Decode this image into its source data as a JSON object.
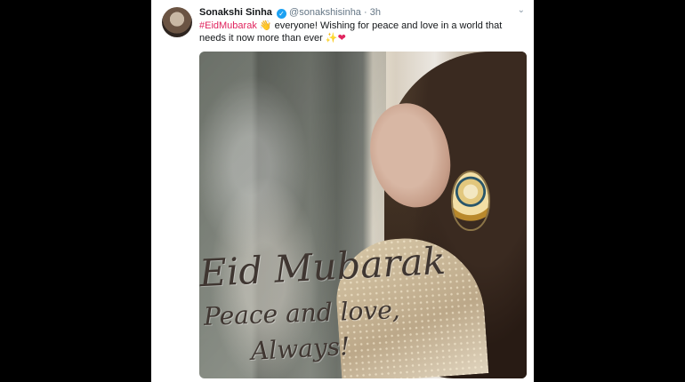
{
  "tweet": {
    "author": {
      "display_name": "Sonakshi Sinha",
      "verified_badge": "✓",
      "handle": "@sonakshisinha",
      "dot": "·",
      "time": "3h"
    },
    "menu_icon": "chevron-down-icon",
    "text": {
      "hashtag": "#EidMubarak",
      "emoji_wave": "👋",
      "body": "everyone! Wishing for peace and love in a world that needs it now more than ever",
      "sparkle": "✨",
      "heart": "❤"
    },
    "media": {
      "overlay_title": "Eid Mubarak",
      "overlay_subtitle": "Peace and love,",
      "overlay_signoff": "Always!"
    },
    "colors": {
      "hashtag": "#e0245e",
      "verified": "#1da1f2",
      "text": "#14171a",
      "muted": "#657786"
    }
  }
}
